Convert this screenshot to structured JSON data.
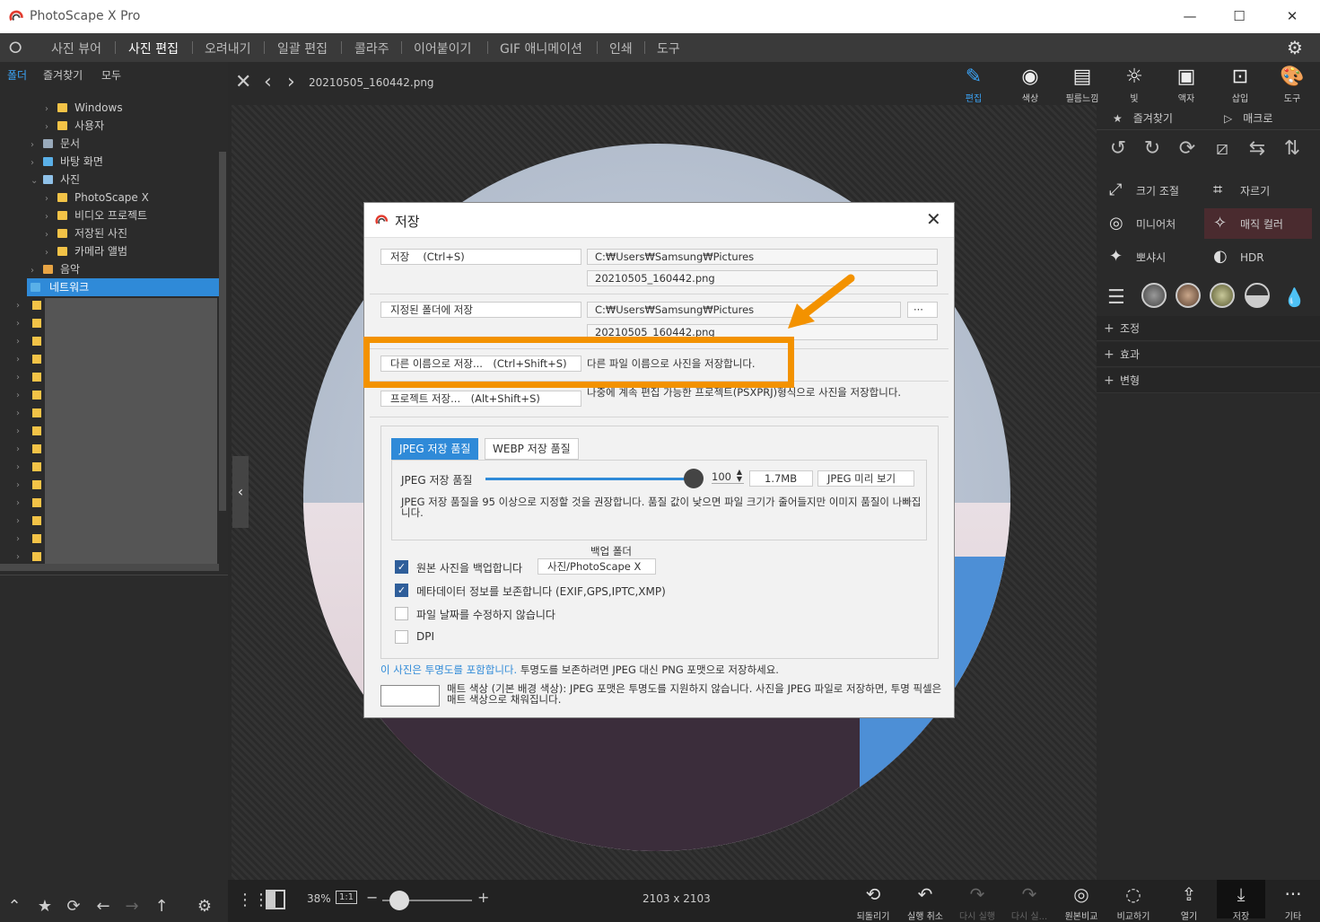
{
  "app": {
    "title": "PhotoScape X Pro"
  },
  "window_buttons": {
    "minimize": "—",
    "maximize": "☐",
    "close": "✕"
  },
  "menu": [
    "사진 뷰어",
    "사진 편집",
    "오려내기",
    "일괄 편집",
    "콜라주",
    "이어붙이기",
    "GIF 애니메이션",
    "인쇄",
    "도구"
  ],
  "menu_active": "사진 편집",
  "sidebar": {
    "tabs": [
      "폴더",
      "즐겨찾기",
      "모두"
    ],
    "tree": [
      {
        "label": "Windows",
        "level": 2
      },
      {
        "label": "사용자",
        "level": 2
      },
      {
        "label": "문서",
        "level": 1
      },
      {
        "label": "바탕 화면",
        "level": 1
      },
      {
        "label": "사진",
        "level": 1,
        "open": true
      },
      {
        "label": "PhotoScape X",
        "level": 2
      },
      {
        "label": "비디오 프로젝트",
        "level": 2
      },
      {
        "label": "저장된 사진",
        "level": 2
      },
      {
        "label": "카메라 앨범",
        "level": 2
      },
      {
        "label": "음악",
        "level": 1
      },
      {
        "label": "네트워크",
        "level": 1,
        "selected": true
      }
    ]
  },
  "image": {
    "filename": "20210505_160442.png",
    "dimensions": "2103 x 2103",
    "zoom": "38%",
    "zoom_ratio": "1:1"
  },
  "tools": [
    "편집",
    "색상",
    "필름느낌",
    "빛",
    "액자",
    "삽입",
    "도구"
  ],
  "right_panel": {
    "favorites": "즐겨찾기",
    "macro": "매크로",
    "features": [
      "크기 조절",
      "자르기",
      "미니어처",
      "매직 컬러",
      "뽀샤시",
      "HDR"
    ],
    "accordions": [
      "조정",
      "효과",
      "변형"
    ]
  },
  "bottom_bar": [
    "되돌리기",
    "실행 취소",
    "다시 실행",
    "다시 실...",
    "원본비교",
    "비교하기",
    "열기",
    "저장",
    "기타"
  ],
  "dialog": {
    "title": "저장",
    "save_btn": "저장 　(Ctrl+S)",
    "save_path": "C:₩Users₩Samsung₩Pictures",
    "save_file": "20210505_160442.png",
    "folder_btn": "지정된 폴더에 저장",
    "folder_path": "C:₩Users₩Samsung₩Pictures",
    "folder_file": "20210505_160442.png",
    "browse": "···",
    "saveas_btn": "다른 이름으로 저장...　(Ctrl+Shift+S)",
    "saveas_desc": "다른 파일 이름으로 사진을 저장합니다.",
    "project_btn": "프로젝트 저장...　(Alt+Shift+S)",
    "project_desc": "나중에 계속 편집 가능한 프로젝트(PSXPRJ)형식으로 사진을 저장합니다.",
    "quality_tabs": [
      "JPEG 저장 품질",
      "WEBP 저장 품질"
    ],
    "quality_label": "JPEG 저장 품질",
    "quality_value": "100",
    "quality_size": "1.7MB",
    "preview_btn": "JPEG 미리 보기",
    "quality_note": "JPEG 저장 품질을 95 이상으로 지정할 것을 권장합니다. 품질 값이 낮으면 파일 크기가 줄어들지만 이미지 품질이 나빠집니다.",
    "backup_folder_label": "백업 폴더",
    "backup_folder": "사진/PhotoScape X",
    "options": [
      {
        "label": "원본 사진을 백업합니다",
        "checked": true
      },
      {
        "label": "메타데이터 정보를 보존합니다 (EXIF,GPS,IPTC,XMP)",
        "checked": true
      },
      {
        "label": "파일 날짜를 수정하지 않습니다",
        "checked": false
      },
      {
        "label": "DPI",
        "checked": false
      }
    ],
    "transparency_link": "이 사진은 투명도를 포함합니다.",
    "transparency_text": " 투명도를 보존하려면 JPEG 대신 PNG 포맷으로 저장하세요.",
    "matte_text": "매트 색상 (기본 배경 색상): JPEG 포맷은 투명도를 지원하지 않습니다. 사진을 JPEG 파일로 저장하면, 투명 픽셀은 매트 색상으로 채워집니다."
  },
  "colors": {
    "accent": "#2f8ad8",
    "highlight": "#f39200"
  }
}
